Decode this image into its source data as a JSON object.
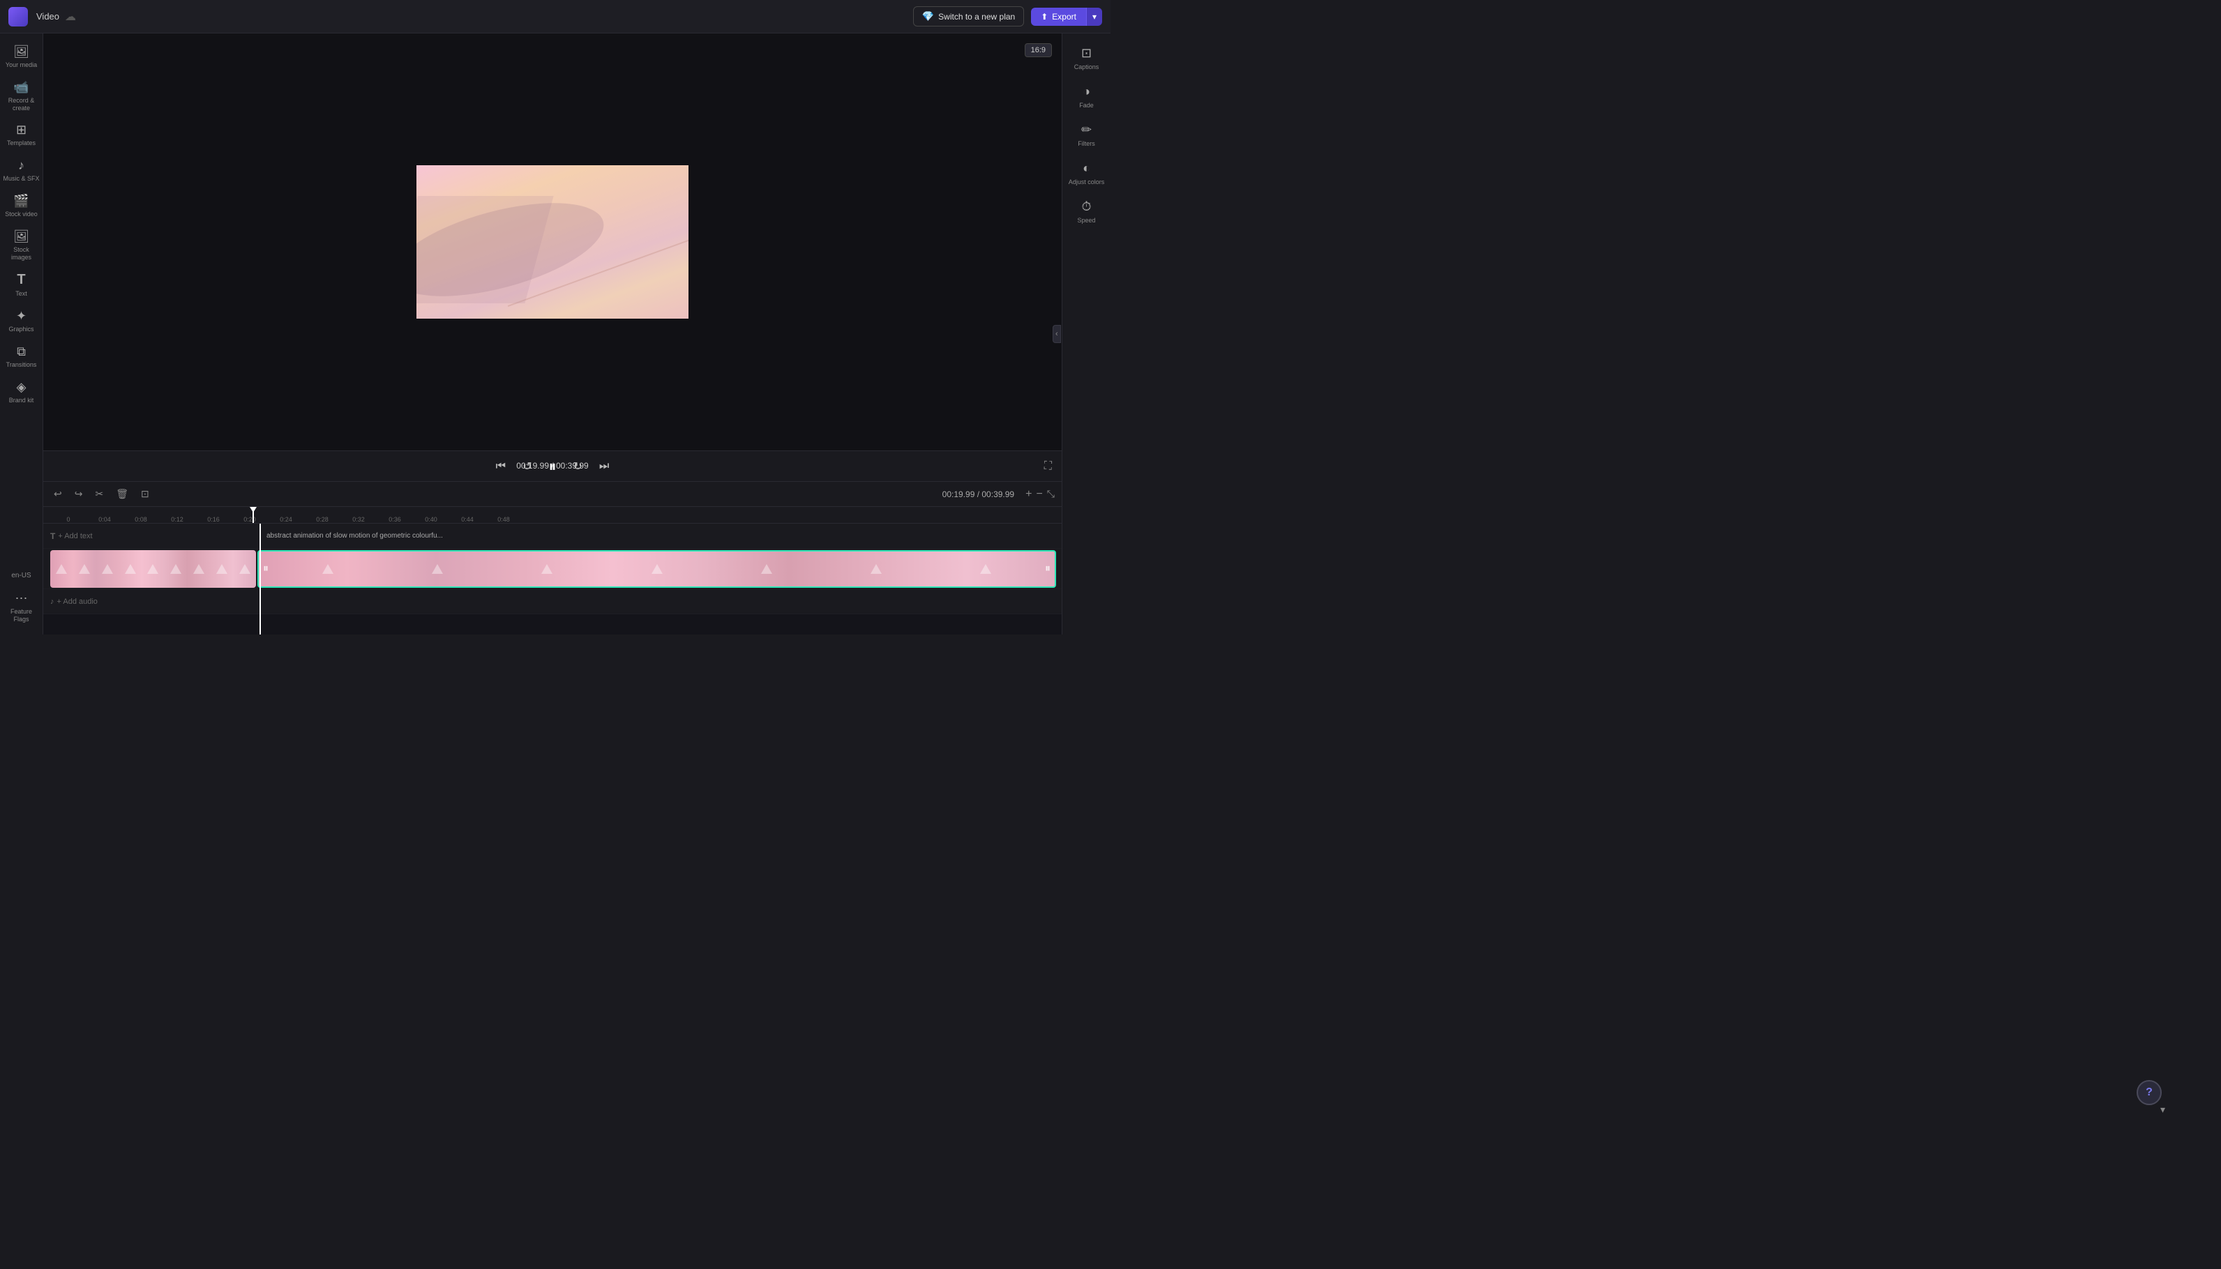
{
  "topbar": {
    "title": "Video",
    "upgrade_label": "Switch to a new plan",
    "export_label": "Export",
    "aspect_ratio": "16:9"
  },
  "sidebar": {
    "items": [
      {
        "id": "your-media",
        "label": "Your media",
        "icon": "🖼"
      },
      {
        "id": "record-create",
        "label": "Record &\ncreate",
        "icon": "📹"
      },
      {
        "id": "templates",
        "label": "Templates",
        "icon": "⊞"
      },
      {
        "id": "music-sfx",
        "label": "Music & SFX",
        "icon": "♪"
      },
      {
        "id": "stock-video",
        "label": "Stock video",
        "icon": "🎬"
      },
      {
        "id": "stock-images",
        "label": "Stock images",
        "icon": "🖼"
      },
      {
        "id": "text",
        "label": "Text",
        "icon": "T"
      },
      {
        "id": "graphics",
        "label": "Graphics",
        "icon": "✦"
      },
      {
        "id": "transitions",
        "label": "Transitions",
        "icon": "⧉"
      },
      {
        "id": "brand",
        "label": "Brand kit",
        "icon": "◈"
      },
      {
        "id": "en-us",
        "label": "en-US",
        "icon": ""
      },
      {
        "id": "feature-flags",
        "label": "Feature Flags",
        "icon": "⋯"
      }
    ]
  },
  "right_tools": [
    {
      "id": "captions",
      "label": "Captions",
      "icon": "⌘"
    },
    {
      "id": "fade",
      "label": "Fade",
      "icon": "◑"
    },
    {
      "id": "filters",
      "label": "Filters",
      "icon": "✏"
    },
    {
      "id": "adjust-colors",
      "label": "Adjust colors",
      "icon": "◐"
    },
    {
      "id": "speed",
      "label": "Speed",
      "icon": "⏱"
    }
  ],
  "playback": {
    "current_time": "00:19.99",
    "total_time": "00:39.99",
    "time_display": "00:19.99 / 00:39.99"
  },
  "timeline": {
    "ruler_marks": [
      "0",
      "0:04",
      "0:08",
      "0:12",
      "0:16",
      "0:20",
      "0:24",
      "0:28",
      "0:32",
      "0:36",
      "0:40",
      "0:44",
      "0:48"
    ],
    "text_track_label": "+ Add text",
    "audio_track_label": "+ Add audio",
    "clip_label": "abstract animation of slow motion of geometric colourfu..."
  }
}
